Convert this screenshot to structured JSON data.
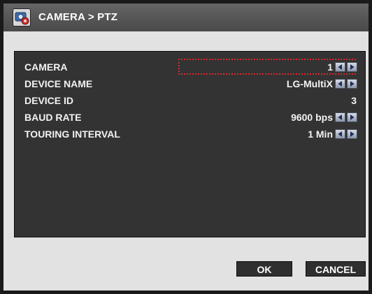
{
  "window": {
    "title": "CAMERA > PTZ",
    "icon": "camera-settings-icon"
  },
  "settings": [
    {
      "label": "CAMERA",
      "value": "1",
      "adjustable": true,
      "focused": true
    },
    {
      "label": "DEVICE NAME",
      "value": "LG-MultiX",
      "adjustable": true
    },
    {
      "label": "DEVICE ID",
      "value": "3",
      "adjustable": false
    },
    {
      "label": "BAUD RATE",
      "value": "9600 bps",
      "adjustable": true
    },
    {
      "label": "TOURING INTERVAL",
      "value": "1 Min",
      "adjustable": true
    }
  ],
  "buttons": {
    "ok_label": "OK",
    "cancel_label": "CANCEL"
  },
  "colors": {
    "focus": "#e0262a",
    "panel": "#333333",
    "window": "#e2e2e2",
    "titlebar": "#555555"
  },
  "icons": {
    "decrement": "arrow-left-icon",
    "increment": "arrow-right-icon"
  }
}
